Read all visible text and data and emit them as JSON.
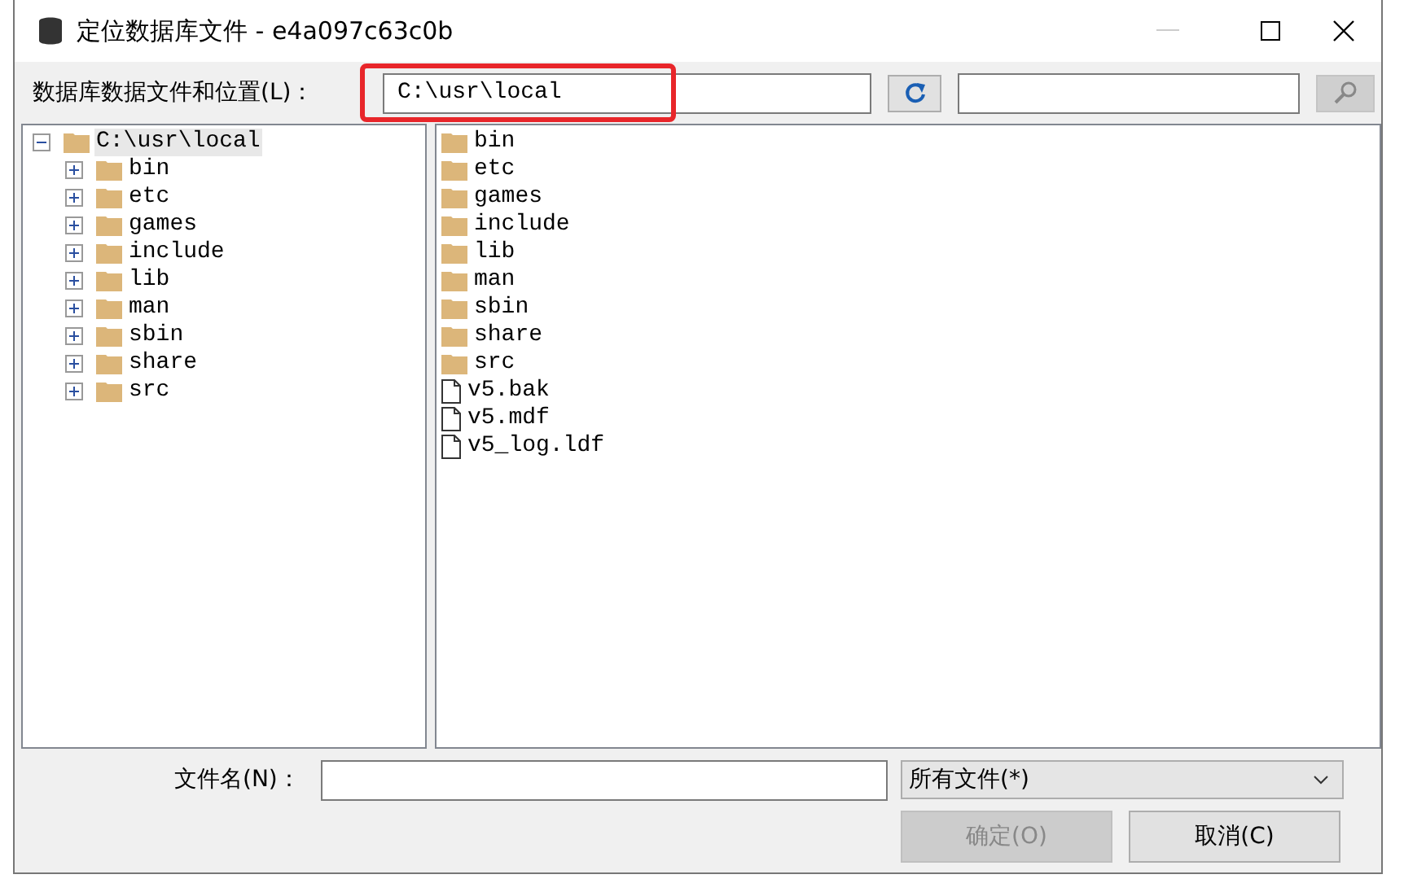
{
  "window": {
    "title": "定位数据库文件 - e4a097c63c0b",
    "minimize_disabled": true
  },
  "location": {
    "label": "数据库数据文件和位置(L)：",
    "value": "C:\\usr\\local",
    "highlighted": true
  },
  "tree": {
    "label": "C:\\usr\\local",
    "expanded": true,
    "selected": true,
    "children": [
      {
        "label": "bin",
        "expanded": false
      },
      {
        "label": "etc",
        "expanded": false
      },
      {
        "label": "games",
        "expanded": false
      },
      {
        "label": "include",
        "expanded": false
      },
      {
        "label": "lib",
        "expanded": false
      },
      {
        "label": "man",
        "expanded": false
      },
      {
        "label": "sbin",
        "expanded": false
      },
      {
        "label": "share",
        "expanded": false
      },
      {
        "label": "src",
        "expanded": false
      }
    ]
  },
  "files": [
    {
      "name": "bin",
      "kind": "folder"
    },
    {
      "name": "etc",
      "kind": "folder"
    },
    {
      "name": "games",
      "kind": "folder"
    },
    {
      "name": "include",
      "kind": "folder"
    },
    {
      "name": "lib",
      "kind": "folder"
    },
    {
      "name": "man",
      "kind": "folder"
    },
    {
      "name": "sbin",
      "kind": "folder"
    },
    {
      "name": "share",
      "kind": "folder"
    },
    {
      "name": "src",
      "kind": "folder"
    },
    {
      "name": "v5.bak",
      "kind": "file"
    },
    {
      "name": "v5.mdf",
      "kind": "file"
    },
    {
      "name": "v5_log.ldf",
      "kind": "file"
    }
  ],
  "file_name": {
    "label": "文件名(N)："
  },
  "file_type": {
    "value": "所有文件(*)"
  },
  "buttons": [
    {
      "label": "确定(O)",
      "disabled": true
    },
    {
      "label": "取消(C)",
      "disabled": false
    }
  ]
}
